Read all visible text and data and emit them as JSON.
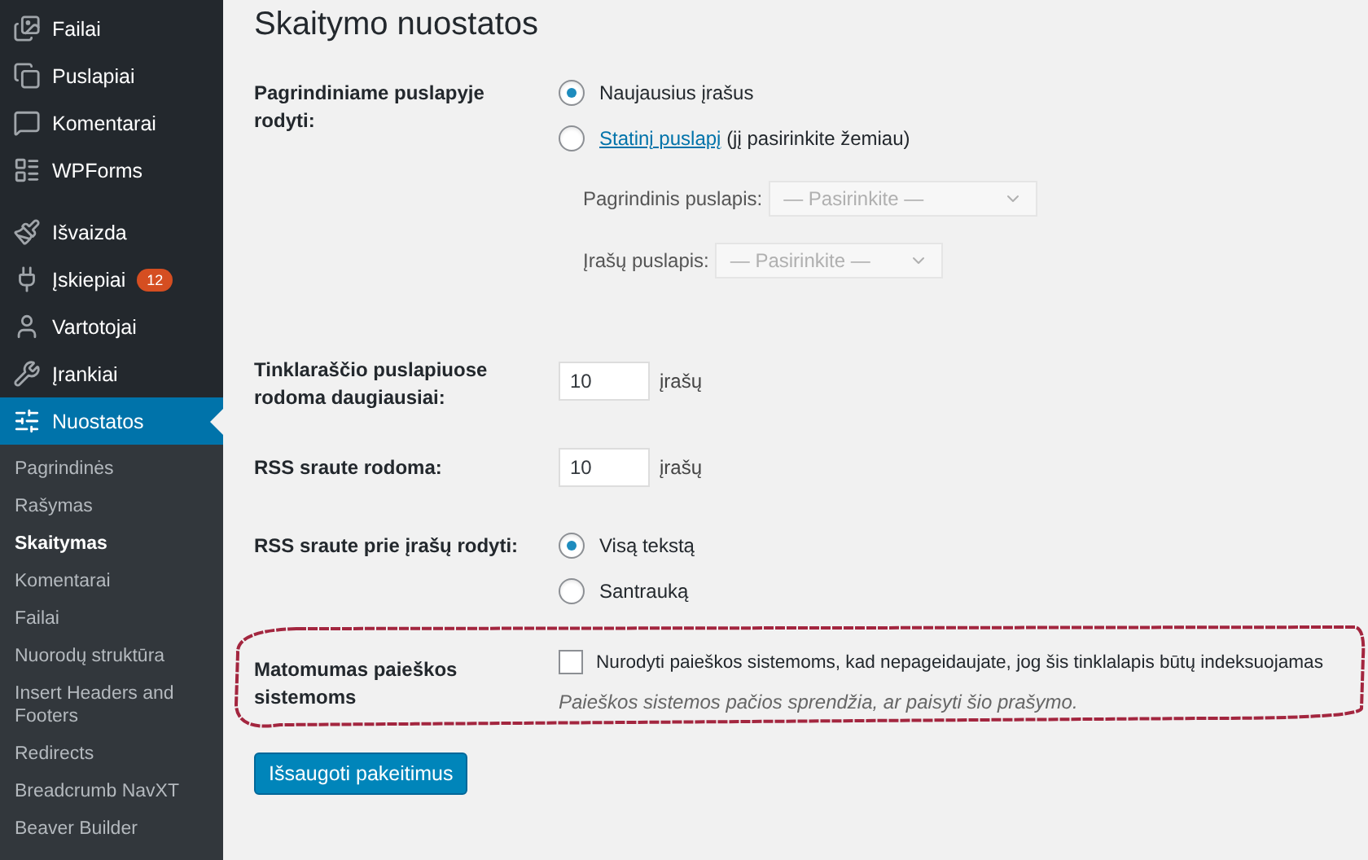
{
  "sidebar": {
    "menu": [
      {
        "label": "Failai",
        "selected": false
      },
      {
        "label": "Puslapiai",
        "selected": false
      },
      {
        "label": "Komentarai",
        "selected": false
      },
      {
        "label": "WPForms",
        "selected": false
      },
      {
        "label": "Išvaizda",
        "selected": false,
        "group_start": true
      },
      {
        "label": "Įskiepiai",
        "selected": false,
        "badge": "12"
      },
      {
        "label": "Vartotojai",
        "selected": false
      },
      {
        "label": "Įrankiai",
        "selected": false
      },
      {
        "label": "Nuostatos",
        "selected": true
      }
    ],
    "submenu": [
      {
        "label": "Pagrindinės",
        "selected": false
      },
      {
        "label": "Rašymas",
        "selected": false
      },
      {
        "label": "Skaitymas",
        "selected": true
      },
      {
        "label": "Komentarai",
        "selected": false
      },
      {
        "label": "Failai",
        "selected": false
      },
      {
        "label": "Nuorodų struktūra",
        "selected": false
      },
      {
        "label": "Insert Headers and Footers",
        "selected": false
      },
      {
        "label": "Redirects",
        "selected": false
      },
      {
        "label": "Breadcrumb NavXT",
        "selected": false
      },
      {
        "label": "Beaver Builder",
        "selected": false
      }
    ]
  },
  "page": {
    "title": "Skaitymo nuostatos",
    "rows": [
      {
        "kind": "radio_group",
        "label": "Pagrindiniame puslapyje rodyti:",
        "options": [
          {
            "label": "Naujausius įrašus",
            "selected": true
          },
          {
            "link": "Statinį puslapį",
            "label": "(jį pasirinkite žemiau)",
            "selected": false
          }
        ],
        "selects": [
          {
            "label": "Pagrindinis puslapis:",
            "value": "— Pasirinkite —",
            "disabled": true
          },
          {
            "label": "Įrašų puslapis:",
            "value": "— Pasirinkite —",
            "disabled": true
          }
        ]
      },
      {
        "kind": "number",
        "label": "Tinklaraščio puslapiuose rodoma daugiausiai:",
        "value": "10",
        "unit": "įrašų"
      },
      {
        "kind": "number",
        "label": "RSS sraute rodoma:",
        "value": "10",
        "unit": "įrašų"
      },
      {
        "kind": "radio_group",
        "label": "RSS sraute prie įrašų rodyti:",
        "options": [
          {
            "label": "Visą tekstą",
            "selected": true
          },
          {
            "label": "Santrauką",
            "selected": false
          }
        ]
      },
      {
        "kind": "checkbox",
        "label": "Matomumas paieškos sistemoms",
        "checked": false,
        "text": "Nurodyti paieškos sistemoms, kad nepageidaujate, jog šis tinklalapis būtų indeksuojamas",
        "description": "Paieškos sistemos pačios sprendžia, ar paisyti šio prašymo.",
        "circled": true
      }
    ],
    "button": "Išsaugoti pakeitimus"
  }
}
